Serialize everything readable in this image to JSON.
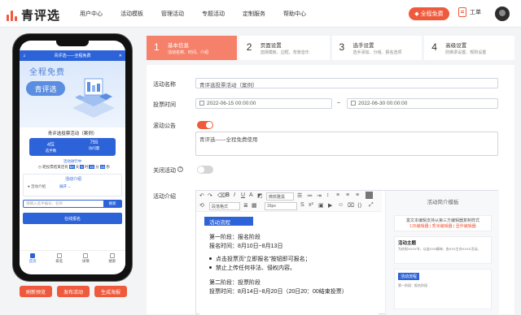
{
  "header": {
    "logo_text": "青评选",
    "nav": [
      "用户中心",
      "活动模板",
      "管理活动",
      "专题活动",
      "定制服务",
      "帮助中心"
    ],
    "free_button": "全程免费",
    "ticket_label": "工单"
  },
  "phone": {
    "topbar_title": "青评选——全程免费",
    "banner_title": "全程免费",
    "banner_brand": "青评选",
    "activity_title": "青评选投票活动（案例）",
    "stats": [
      {
        "value": "4位",
        "label": "选手数"
      },
      {
        "value": "755",
        "label": "访问量"
      }
    ],
    "countdown_label": "活动进行中",
    "countdown_text": "距投票结束还有",
    "countdown_values": [
      "84",
      "5",
      "41",
      "11"
    ],
    "countdown_units": [
      "天",
      "时",
      "分",
      "秒"
    ],
    "intro_title": "活动介绍",
    "intro_label": "活动介绍",
    "intro_expand": "展开",
    "search_placeholder": "请输入选手编号、名称",
    "search_button": "搜索",
    "signup_button": "在线报名",
    "tabs": [
      "首页",
      "排名",
      "详情",
      "搜索"
    ],
    "actions": [
      "刷新预览",
      "发布活动",
      "生成海报"
    ]
  },
  "steps": [
    {
      "num": "1",
      "title": "基本信息",
      "desc": "活动名称、时间、介绍"
    },
    {
      "num": "2",
      "title": "页面设置",
      "desc": "选择模板、边框、背景音乐"
    },
    {
      "num": "3",
      "title": "选手设置",
      "desc": "选手添加、分组、报名选项"
    },
    {
      "num": "4",
      "title": "高级设置",
      "desc": "防刷票设置、规则设置"
    }
  ],
  "form": {
    "name_label": "活动名称",
    "name_value": "青评选投票活动（案例）",
    "time_label": "投票时间",
    "start_time": "2022-06-15 00:00:00",
    "end_time": "2022-06-30 00:00:00",
    "time_sep": "~",
    "notice_label": "滚动公告",
    "notice_value": "青评选——全程免费使用",
    "close_label": "关闭活动",
    "intro_label": "活动介绍",
    "font_family": "微软雅黑",
    "para_format": "段落格式",
    "font_size": "16px",
    "editor": {
      "heading": "活动流程",
      "lines": [
        "第一阶段：报名阶段",
        "报名时间：8月10日~8月13日"
      ],
      "bullets": [
        "点击投票页“立即报名”按钮即可报名；",
        "禁止上传任何非法、侵权内容。"
      ],
      "lines2": [
        "第二阶段：投票阶段",
        "投票时间：8月14日~8月20日（20日20：00结束投票）"
      ]
    },
    "template": {
      "title": "活动简介模板",
      "box_text": "富文本编辑支持从第三方编辑器复制样式",
      "box_links": "135编辑器 | 秀米编辑器 | 壹伴编辑器",
      "card1_title": "活动主题",
      "card1_text": "为庆祝XXXX节，以益XXX精神，由XXX主办XXXX活动。",
      "card2_badge": "活动流程",
      "card2_text": "第一阶段：报名阶段"
    }
  }
}
